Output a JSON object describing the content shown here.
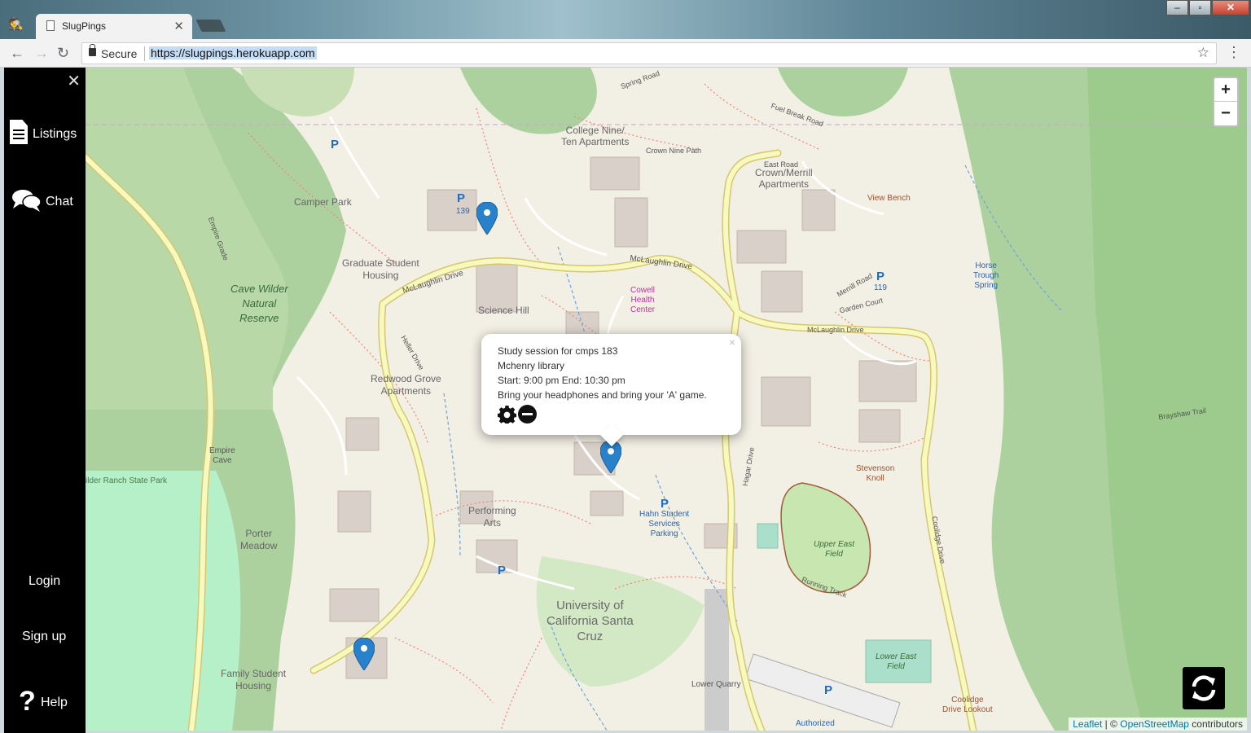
{
  "browser": {
    "tab_title": "SlugPings",
    "tab_close": "✕",
    "secure_label": "Secure",
    "url": "https://slugpings.herokuapp.com"
  },
  "sidebar": {
    "close": "✕",
    "listings": "Listings",
    "chat": "Chat",
    "login": "Login",
    "signup": "Sign up",
    "help": "Help",
    "help_glyph": "?"
  },
  "map": {
    "zoom_in": "+",
    "zoom_out": "−",
    "labels": {
      "college_nine": "College Nine/\nTen Apartments",
      "crown_merrill": "Crown/Merrill\nApartments",
      "camper_park": "Camper Park",
      "graduate_housing": "Graduate Student\nHousing",
      "cave_wilder": "Cave Wilder\nNatural\nReserve",
      "science_hill": "Science Hill",
      "redwood_grove": "Redwood Grove\nApartments",
      "empire_cave": "Empire\nCave",
      "wilder_ranch": "ilder Ranch State Park",
      "porter_meadow": "Porter\nMeadow",
      "performing_arts": "Performing\nArts",
      "hahn_parking": "Hahn Student\nServices\nParking",
      "ucsc": "University of\nCalifornia Santa\nCruz",
      "family_housing": "Family Student\nHousing",
      "lower_quarry": "Lower Quarry",
      "upper_east_field": "Upper East\nField",
      "lower_east_field": "Lower East\nField",
      "stevenson_knoll": "Stevenson\nKnoll",
      "coolidge_lookout": "Coolidge\nDrive Lookout",
      "view_bench": "View Bench",
      "horse_trough": "Horse\nTrough\nSpring",
      "cowell_health": "Cowell\nHealth\nCenter",
      "mclaughlin_w": "McLaughlin Drive",
      "mclaughlin_mid": "McLaughlin Drive",
      "mclaughlin_e": "McLaughlin Drive",
      "east_road": "East Road",
      "spring_road": "Spring Road",
      "crown_nine_path": "Crown Nine Path",
      "fuel_break": "Fuel Break Road",
      "garden_court": "Garden Court",
      "merrill_road": "Merrill Road",
      "running_track": "Running Track",
      "brayshaw": "Brayshaw Trail",
      "heller_drive": "Heller Drive",
      "hagar_drive": "Hagar Drive",
      "coolidge_drive": "Coolidge Drive",
      "empire_grade": "Empire Grade",
      "p139": "139",
      "p119": "119",
      "authorized": "Authorized"
    },
    "parking_symbol": "P",
    "attribution": {
      "leaflet": "Leaflet",
      "sep": " | © ",
      "osm": "OpenStreetMap",
      "contributors": " contributors"
    }
  },
  "popup": {
    "close": "×",
    "title": "Study session for cmps 183",
    "location": "Mchenry library",
    "time": "Start: 9:00 pm End: 10:30 pm",
    "description": "Bring your headphones and bring your 'A' game."
  },
  "colors": {
    "sidebar_bg": "#000000",
    "map_bg": "#f2efe4",
    "forest": "#add19e",
    "wood": "#8ec481",
    "road_yellow": "#f7fabf",
    "marker_blue": "#2a81cb"
  }
}
